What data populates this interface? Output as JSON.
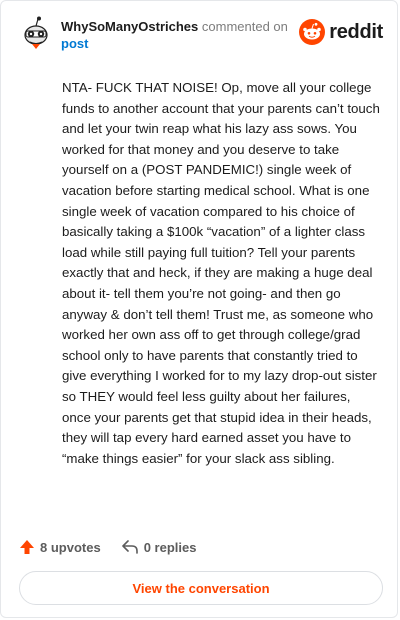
{
  "header": {
    "username": "WhySoManyOstriches",
    "action_text": "commented on",
    "post_link": "post",
    "brand": "reddit",
    "icons": {
      "avatar": "snoo-avatar-icon",
      "logo": "reddit-logo-icon"
    }
  },
  "comment": {
    "text": "NTA- FUCK THAT NOISE! Op, move all your college funds to another account that your parents can’t touch and let your twin reap what his lazy ass sows. You worked for that money and you deserve to take yourself on a (POST PANDEMIC!) single week of vacation before starting medical school. What is one single week of vacation compared to his choice of basically taking a $100k “vacation” of a lighter class load while still paying full tuition? Tell your parents exactly that and heck, if they are making a huge deal about it- tell them you’re not going- and then go anyway & don’t tell them! Trust me, as someone who worked her own ass off to get through college/grad school only to have parents that constantly tried to give everything I worked for to my lazy drop-out sister so THEY would feel less guilty about her failures, once your parents get that stupid idea in their heads, they will tap every hard earned asset you have to “make things easier” for your slack ass sibling."
  },
  "actions": {
    "upvotes": "8 upvotes",
    "replies": "0 replies",
    "icons": {
      "upvote": "upvote-arrow-icon",
      "reply": "reply-arrow-icon"
    }
  },
  "footer": {
    "button_label": "View the conversation"
  },
  "colors": {
    "accent": "#ff4500",
    "link": "#0079d3",
    "text": "#1c1c1c",
    "muted": "#7c7c7c"
  }
}
